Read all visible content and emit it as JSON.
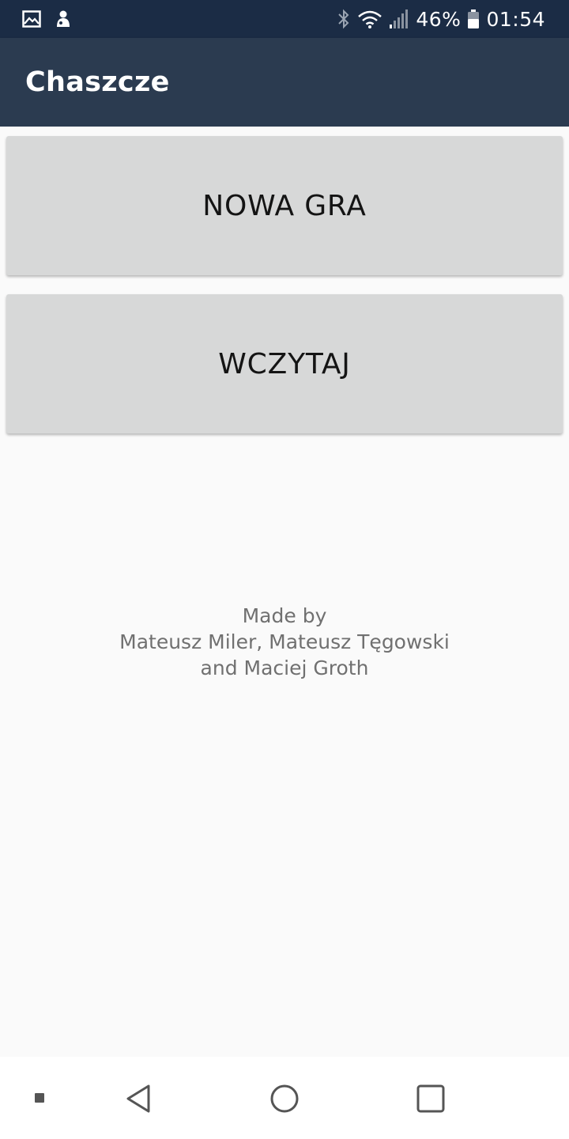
{
  "status_bar": {
    "battery_percent": "46%",
    "time": "01:54",
    "icons": [
      "gallery-icon",
      "notification-icon",
      "bluetooth-icon",
      "wifi-icon",
      "signal-icon",
      "battery-icon"
    ]
  },
  "app_bar": {
    "title": "Chaszcze"
  },
  "main": {
    "new_game_label": "NOWA GRA",
    "load_label": "WCZYTAJ"
  },
  "credits": {
    "line1": "Made by",
    "line2": "Mateusz Miler, Mateusz Tęgowski",
    "line3": "and Maciej Groth"
  },
  "nav_bar": {
    "icons": [
      "nav-dot-icon",
      "back-icon",
      "home-icon",
      "recents-icon"
    ]
  },
  "colors": {
    "status_bar": "#1b2c45",
    "app_bar": "#2b3b50",
    "button": "#d7d8d8",
    "background": "#fafafa",
    "credits_text": "#707070"
  }
}
